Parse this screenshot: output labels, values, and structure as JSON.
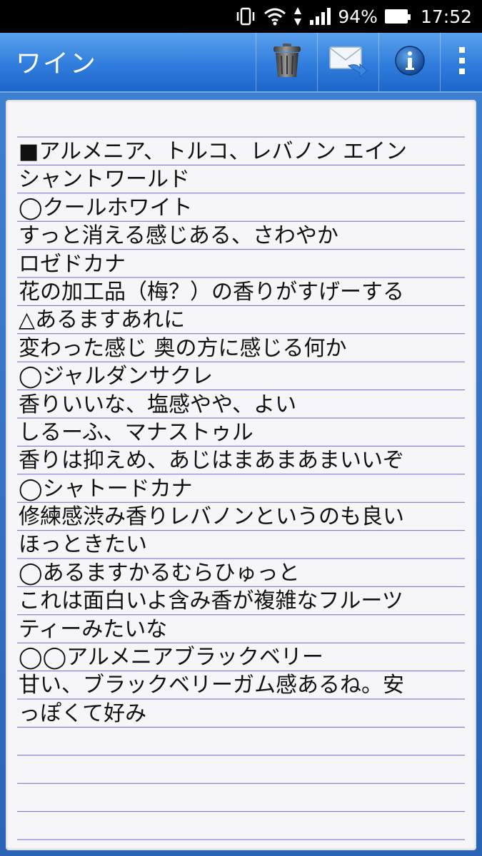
{
  "status_bar": {
    "battery": "94%",
    "time": "17:52",
    "icons": [
      "vibrate-icon",
      "wifi-icon",
      "data-arrows-icon",
      "signal-icon",
      "battery-icon"
    ]
  },
  "app_bar": {
    "title": "ワイン",
    "actions": [
      {
        "name": "delete-button",
        "icon": "trash-icon"
      },
      {
        "name": "share-mail-button",
        "icon": "mail-icon"
      },
      {
        "name": "info-button",
        "icon": "info-icon"
      },
      {
        "name": "overflow-menu-button",
        "icon": "more-vert-icon"
      }
    ]
  },
  "note": {
    "lines": [
      "■アルメニア、トルコ、レバノン エイン",
      "シャントワールド",
      "◯クールホワイト",
      "すっと消える感じある、さわやか",
      "ロゼドカナ",
      "花の加工品（梅？）の香りがすげーする",
      "△あるますあれに",
      "変わった感じ 奥の方に感じる何か",
      "◯ジャルダンサクレ",
      "香りいいな、塩感やや、よい",
      "しるーふ、マナストゥル",
      "香りは抑えめ、あじはまあまあまいいぞ",
      "◯シャトードカナ",
      "修練感渋み香りレバノンというのも良い",
      "ほっときたい",
      "◯あるますかるむらひゅっと",
      "これは面白いよ含み香が複雑なフルーツ",
      "ティーみたいな",
      "◯◯アルメニアブラックベリー",
      "甘い、ブラックベリーガム感あるね。安",
      "っぽくて好み"
    ]
  }
}
